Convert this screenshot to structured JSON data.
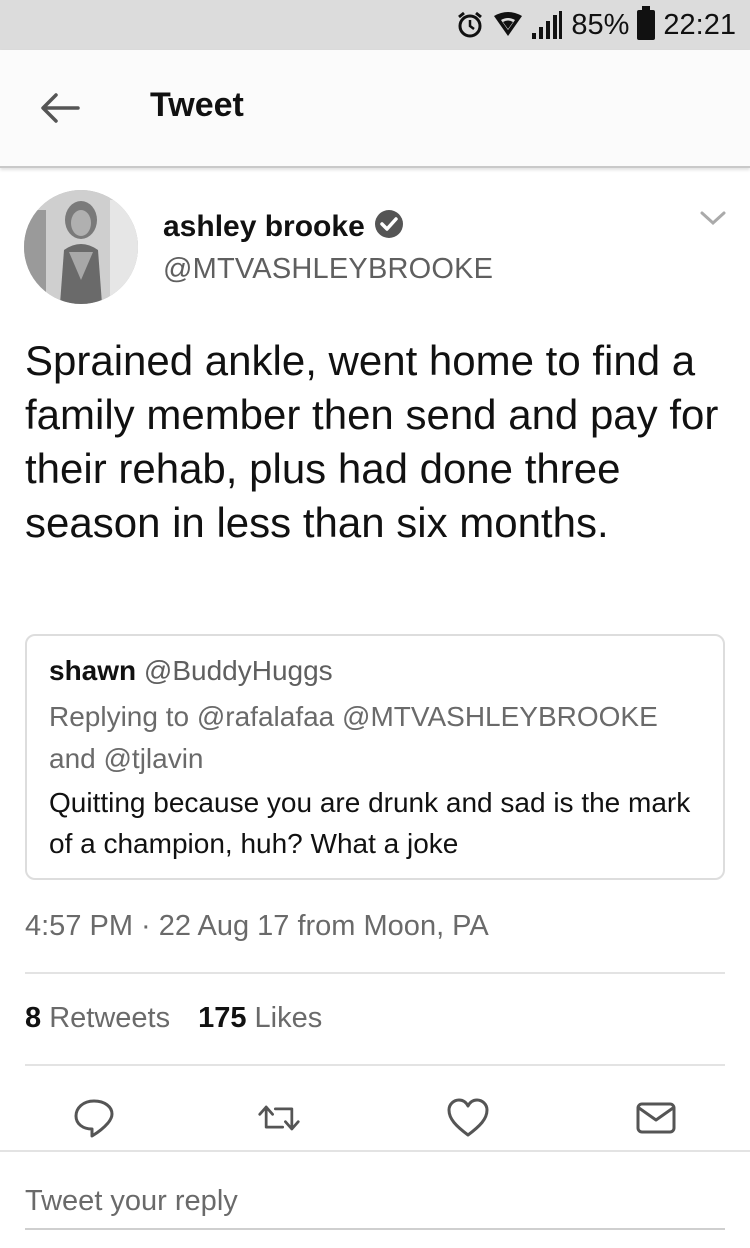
{
  "status_bar": {
    "battery": "85%",
    "time": "22:21",
    "icons": [
      "alarm-icon",
      "wifi-icon",
      "signal-icon",
      "battery-icon"
    ]
  },
  "header": {
    "title": "Tweet",
    "back_icon": "arrow-left-icon"
  },
  "tweet": {
    "author_name": "ashley brooke",
    "author_handle": "@MTVASHLEYBROOKE",
    "verified_icon": "verified-badge-icon",
    "text": "Sprained ankle, went home to find a family member then send and pay for their rehab, plus had done three season in less than six months.",
    "quoted": {
      "name": "shawn",
      "handle": "@BuddyHuggs",
      "reply_line": "Replying to @rafalafaa @MTVASHLEYBROOKE and @tjlavin",
      "text": "Quitting because you are drunk and sad is the mark of a champion, huh? What a joke"
    },
    "timestamp": "4:57 PM · 22 Aug 17",
    "location": "from Moon, PA",
    "retweets_count": "8",
    "retweets_label": "Retweets",
    "likes_count": "175",
    "likes_label": "Likes"
  },
  "actions": [
    "reply-icon",
    "retweet-icon",
    "like-icon",
    "message-icon"
  ],
  "reply": {
    "placeholder": "Tweet your reply"
  },
  "colors": {
    "status_bar_bg": "#dcdcdc",
    "text_primary": "#111111",
    "text_secondary": "#6a6a6a"
  }
}
